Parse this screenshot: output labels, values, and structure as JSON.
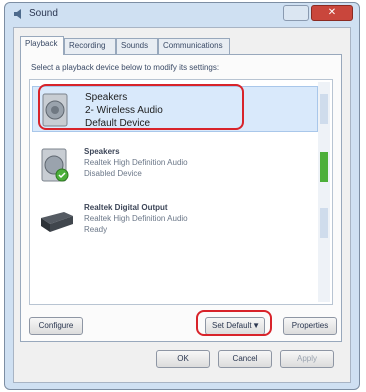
{
  "window": {
    "title": "Sound"
  },
  "tabs": [
    "Playback",
    "Recording",
    "Sounds",
    "Communications"
  ],
  "instruction": "Select a playback device below to modify its settings:",
  "devices": [
    {
      "name": "Speakers",
      "line2": "2- Wireless Audio",
      "line3": "Default Device",
      "selected": true
    },
    {
      "name": "Speakers",
      "line2": "Realtek High Definition Audio",
      "line3": "Disabled Device",
      "selected": false
    },
    {
      "name": "Realtek Digital Output",
      "line2": "Realtek High Definition Audio",
      "line3": "Ready",
      "selected": false
    }
  ],
  "buttons": {
    "configure": "Configure",
    "set_default": "Set Default",
    "properties": "Properties",
    "ok": "OK",
    "cancel": "Cancel",
    "apply": "Apply"
  },
  "colors": {
    "callout": "#d8232a",
    "selection": "#d9e9fb",
    "level_active": "#4caf3a"
  }
}
